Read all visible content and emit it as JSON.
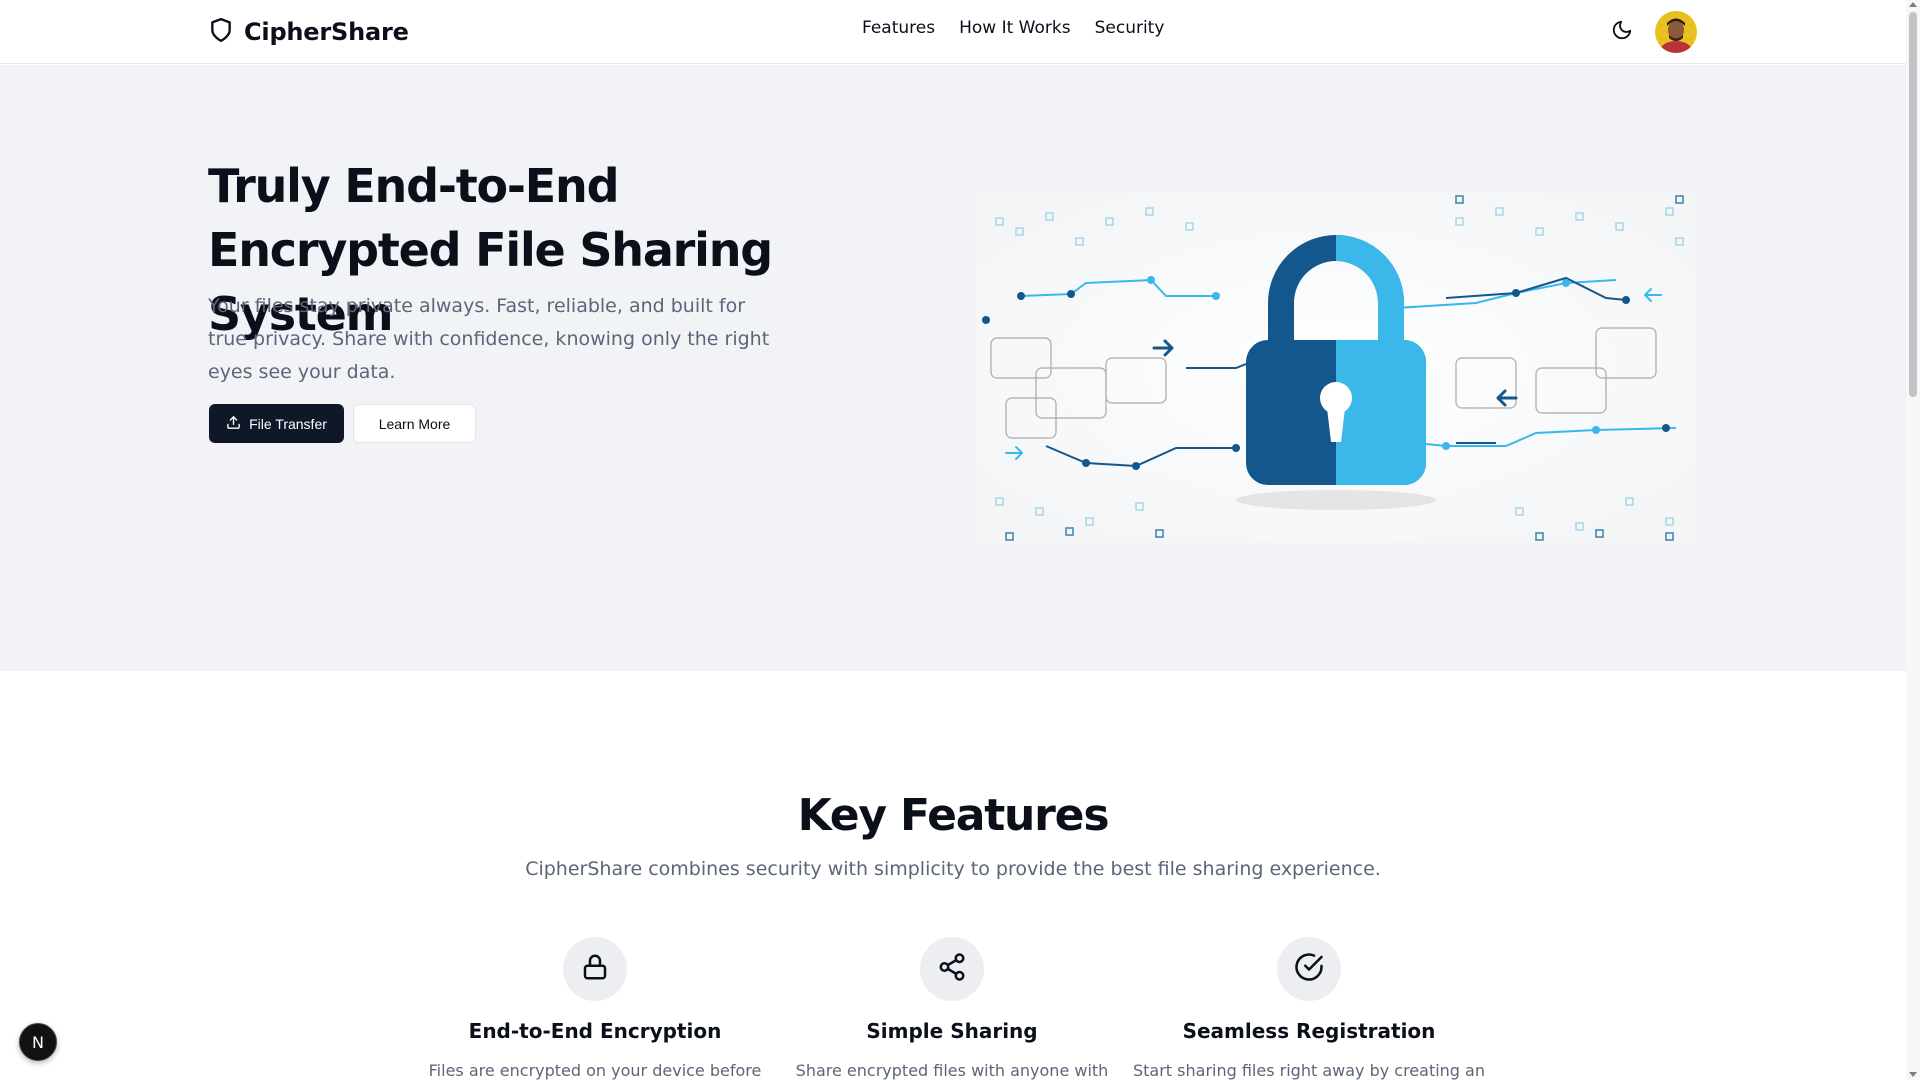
{
  "header": {
    "brand": "CipherShare",
    "nav": [
      "Features",
      "How It Works",
      "Security"
    ]
  },
  "hero": {
    "title": "Truly End-to-End Encrypted File Sharing System",
    "subtitle": "Your files stay private always. Fast, reliable, and built for true privacy. Share with confidence, knowing only the right eyes see your data.",
    "primary_button": "File Transfer",
    "secondary_button": "Learn More"
  },
  "features": {
    "title": "Key Features",
    "subtitle": "CipherShare combines security with simplicity to provide the best file sharing experience.",
    "items": [
      {
        "title": "End-to-End Encryption",
        "desc": "Files are encrypted on your device before",
        "icon": "lock-icon"
      },
      {
        "title": "Simple Sharing",
        "desc": "Share encrypted files with anyone with",
        "icon": "share-icon"
      },
      {
        "title": "Seamless Registration",
        "desc": "Start sharing files right away by creating an",
        "icon": "check-circle-icon"
      }
    ]
  },
  "dev_badge": "N",
  "colors": {
    "primary": "#0f1729",
    "hero_bg": "#f1f3f6",
    "muted_text": "#5b6678",
    "lock_dark": "#14578c",
    "lock_light": "#3bb8ea"
  }
}
